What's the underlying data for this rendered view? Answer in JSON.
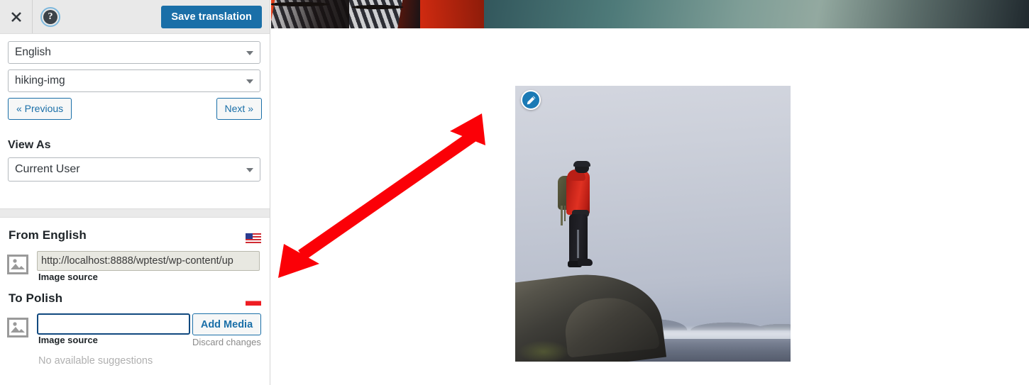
{
  "toolbar": {
    "close_icon": "close-icon",
    "help_icon": "help-icon",
    "help_glyph": "?",
    "save_label": "Save translation",
    "accent_color": "#1a6fa8",
    "bg_color": "#e9e9e9"
  },
  "selectors": {
    "language": {
      "value": "English",
      "caret_icon": "chevron-down-icon"
    },
    "string_name": {
      "value": "hiking-img",
      "caret_icon": "chevron-down-icon"
    }
  },
  "navigation": {
    "previous_label": "« Previous",
    "next_label": "Next »"
  },
  "view_as": {
    "heading": "View As",
    "value": "Current User",
    "caret_icon": "chevron-down-icon"
  },
  "source_section": {
    "heading": "From English",
    "flag_icon": "us-flag-icon",
    "thumb_icon": "image-placeholder-icon",
    "value": "http://localhost:8888/wptest/wp-content/up",
    "sub_label": "Image source"
  },
  "target_section": {
    "heading": "To Polish",
    "flag_icon": "poland-flag-icon",
    "thumb_icon": "image-placeholder-icon",
    "value": "",
    "placeholder": "",
    "sub_label": "Image source",
    "add_media_label": "Add Media",
    "discard_label": "Discard changes",
    "suggestions_text": "No available suggestions"
  },
  "main": {
    "banner_alt": "cropped header photo of red jacket and lake",
    "photo_alt": "hiker in red jacket standing on rocky cliff above clouds",
    "edit_badge_icon": "pencil-icon",
    "annotation_icon": "double-headed-arrow-annotation",
    "annotation_color": "#fb0007"
  }
}
